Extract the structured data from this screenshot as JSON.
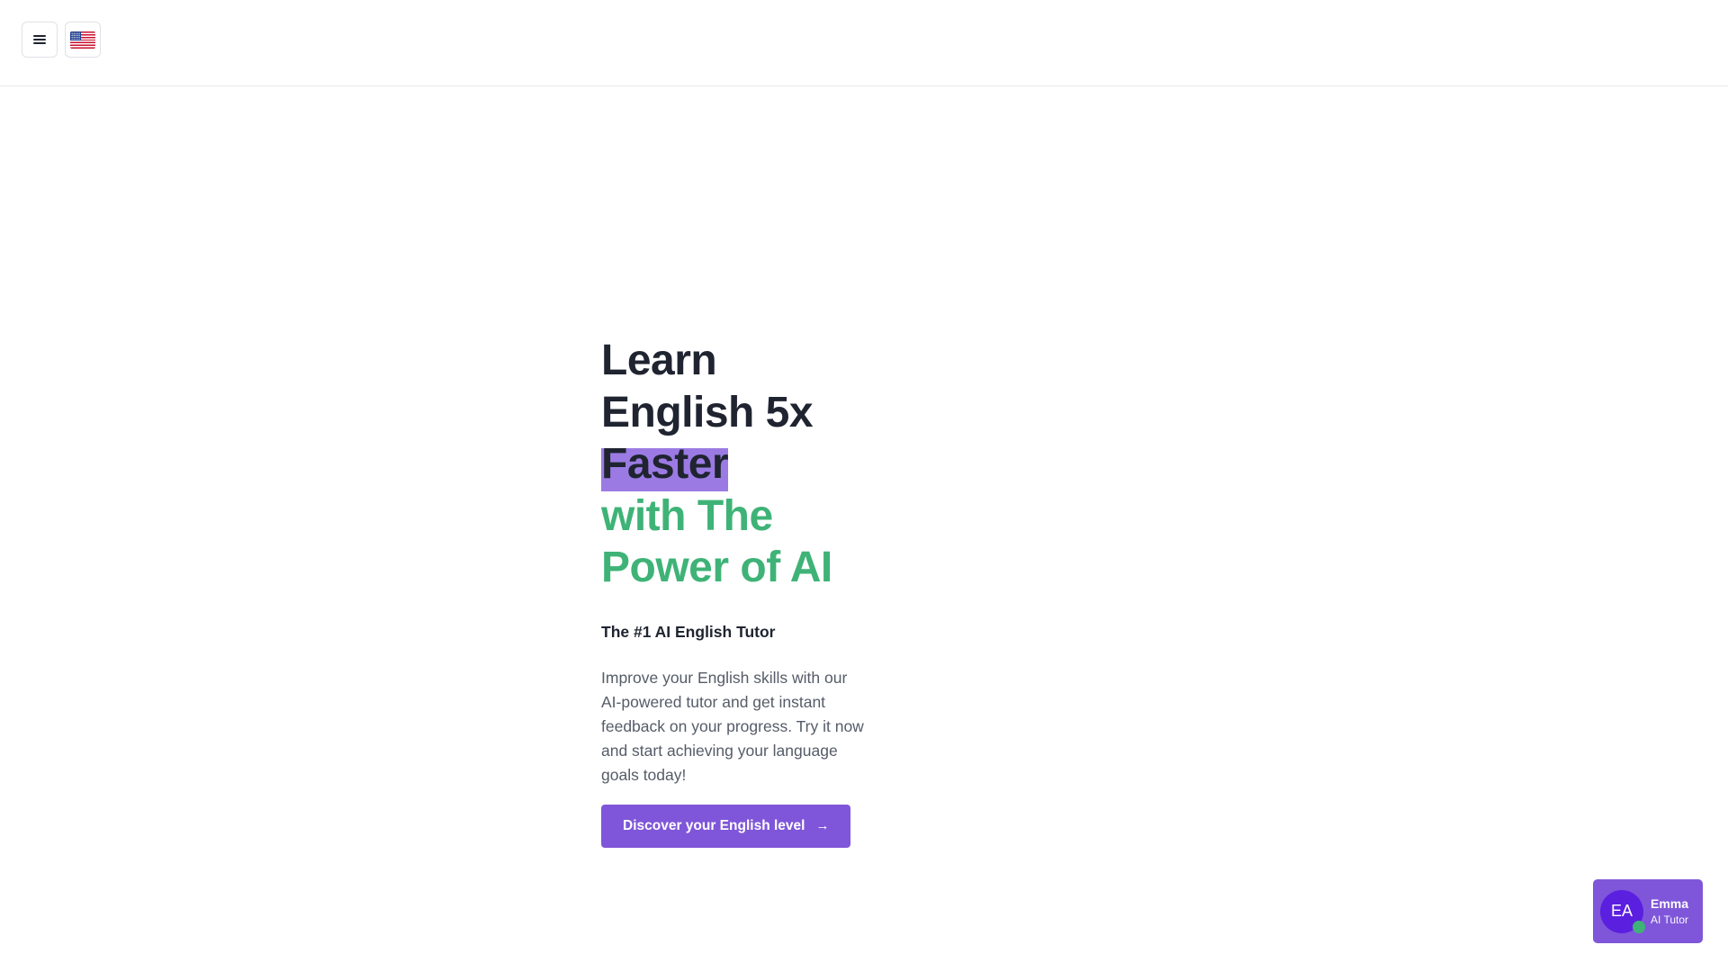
{
  "header": {
    "menu_icon": "hamburger-menu-icon",
    "language_flag_icon": "us-flag-icon"
  },
  "hero": {
    "headline_line1": "Learn",
    "headline_line2": "English 5x",
    "headline_highlight": "Faster",
    "headline_accent_line1": "with The",
    "headline_accent_line2": "Power of AI",
    "subtitle": "The #1 AI English Tutor",
    "description": "Improve your English skills with our AI-powered tutor and get instant feedback on your progress. Try it now and start achieving your language goals today!",
    "cta_label": "Discover your English level",
    "cta_icon": "arrow-right-icon"
  },
  "tutor_widget": {
    "initials": "EA",
    "name": "Emma",
    "role": "AI Tutor"
  },
  "colors": {
    "primary_purple": "#7f56d9",
    "highlight_purple": "#9b7be3",
    "avatar_purple": "#5b1fe0",
    "accent_green": "#3fb377",
    "text_dark": "#1f2430",
    "text_muted": "#555c68"
  }
}
